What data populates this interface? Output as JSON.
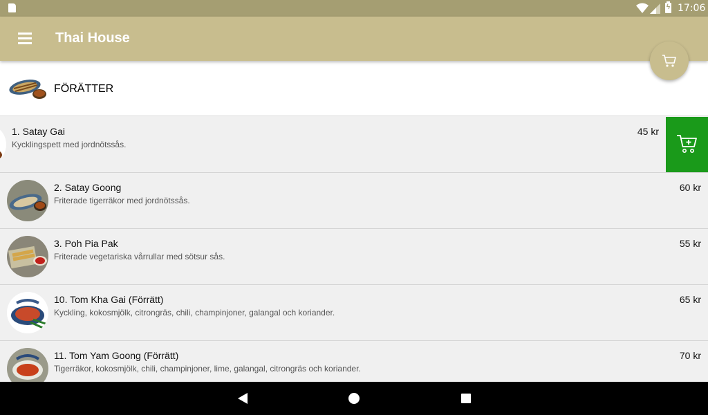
{
  "status_bar": {
    "time": "17:06"
  },
  "app_bar": {
    "title": "Thai House"
  },
  "category": {
    "title": "FÖRÄTTER"
  },
  "items": [
    {
      "name": "1.  Satay Gai",
      "description": "Kycklingspett med jordnötssås.",
      "price": "45 kr"
    },
    {
      "name": "2.  Satay Goong",
      "description": "Friterade tigerräkor med jordnötssås.",
      "price": "60 kr"
    },
    {
      "name": "3. Poh Pia Pak",
      "description": "Friterade vegetariska vårrullar med sötsur sås.",
      "price": "55 kr"
    },
    {
      "name": "10. Tom Kha Gai (Förrätt)",
      "description": "Kyckling, kokosmjölk, citrongräs, chili, champinjoner, galangal och koriander.",
      "price": "65 kr"
    },
    {
      "name": "11. Tom Yam Goong (Förrätt)",
      "description": "Tigerräkor, kokosmjölk, chili, champinjoner, lime, galangal, citrongräs och koriander.",
      "price": "70 kr"
    }
  ],
  "colors": {
    "app_bar": "#c8bd8e",
    "status_bar": "#a59e72",
    "add_to_cart": "#1a9a1a"
  },
  "icons": {
    "menu": "hamburger-icon",
    "cart": "cart-icon",
    "add_to_cart": "cart-plus-icon",
    "back": "back-icon",
    "home": "home-icon",
    "recent": "recent-apps-icon"
  }
}
